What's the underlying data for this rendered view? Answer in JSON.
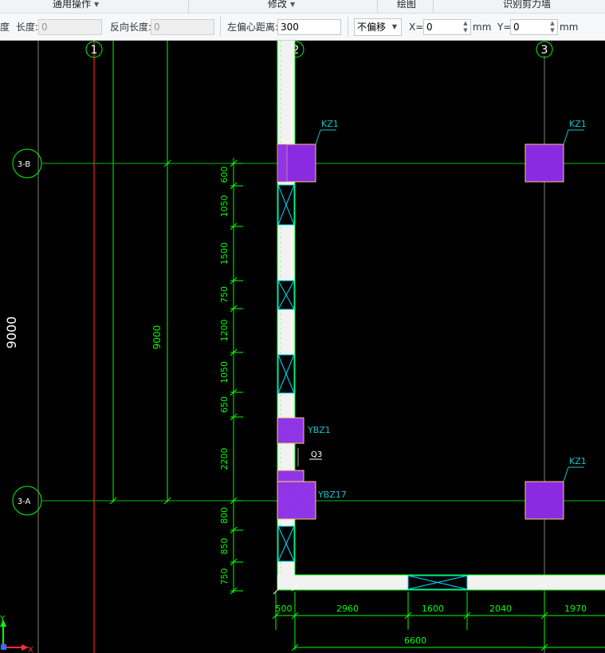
{
  "menu": {
    "general_ops": "通用操作",
    "modify": "修改",
    "draw": "绘图",
    "recognize_shear_wall": "识别剪力墙"
  },
  "toolbar": {
    "cut_label": "度",
    "length_label": "长度:",
    "length_value": "0",
    "reverse_length_label": "反向长度:",
    "reverse_length_value": "0",
    "left_offset_label": "左偏心距离:",
    "left_offset_value": "300",
    "offset_mode": "不偏移",
    "x_label": "X=",
    "x_value": "0",
    "x_unit": "mm",
    "y_label": "Y=",
    "y_value": "0",
    "y_unit": "mm"
  },
  "drawing": {
    "axes_vertical": [
      "1",
      "2",
      "3"
    ],
    "axes_horizontal": [
      "3-B",
      "3-A"
    ],
    "overall_dim_left": "9000",
    "overall_dim_inner": "9000",
    "wall_segment_dims": [
      "600",
      "1050",
      "1500",
      "750",
      "1200",
      "1050",
      "650",
      "2200",
      "800",
      "850",
      "750"
    ],
    "bottom_dims": [
      "500",
      "2960",
      "1600",
      "2040",
      "1970"
    ],
    "bottom_total": "6600",
    "column_labels": {
      "kz1_top_left": "KZ1",
      "kz1_top_right": "KZ1",
      "kz1_bottom_right": "KZ1",
      "ybz1": "YBZ1",
      "ybz17": "YBZ17",
      "lintel": "Q3"
    },
    "ucs": {
      "y": "Y",
      "x": "X"
    }
  },
  "colors": {
    "background": "#000000",
    "grid_line": "#808080",
    "axis_red": "#ff2020",
    "dimension_green": "#00ff00",
    "wall_fill": "#f2f2f2",
    "opening_cyan": "#00e0ff",
    "column_purple": "#8a2be2",
    "column_border": "#ffcc66",
    "label_cyan": "#19c3c8"
  }
}
